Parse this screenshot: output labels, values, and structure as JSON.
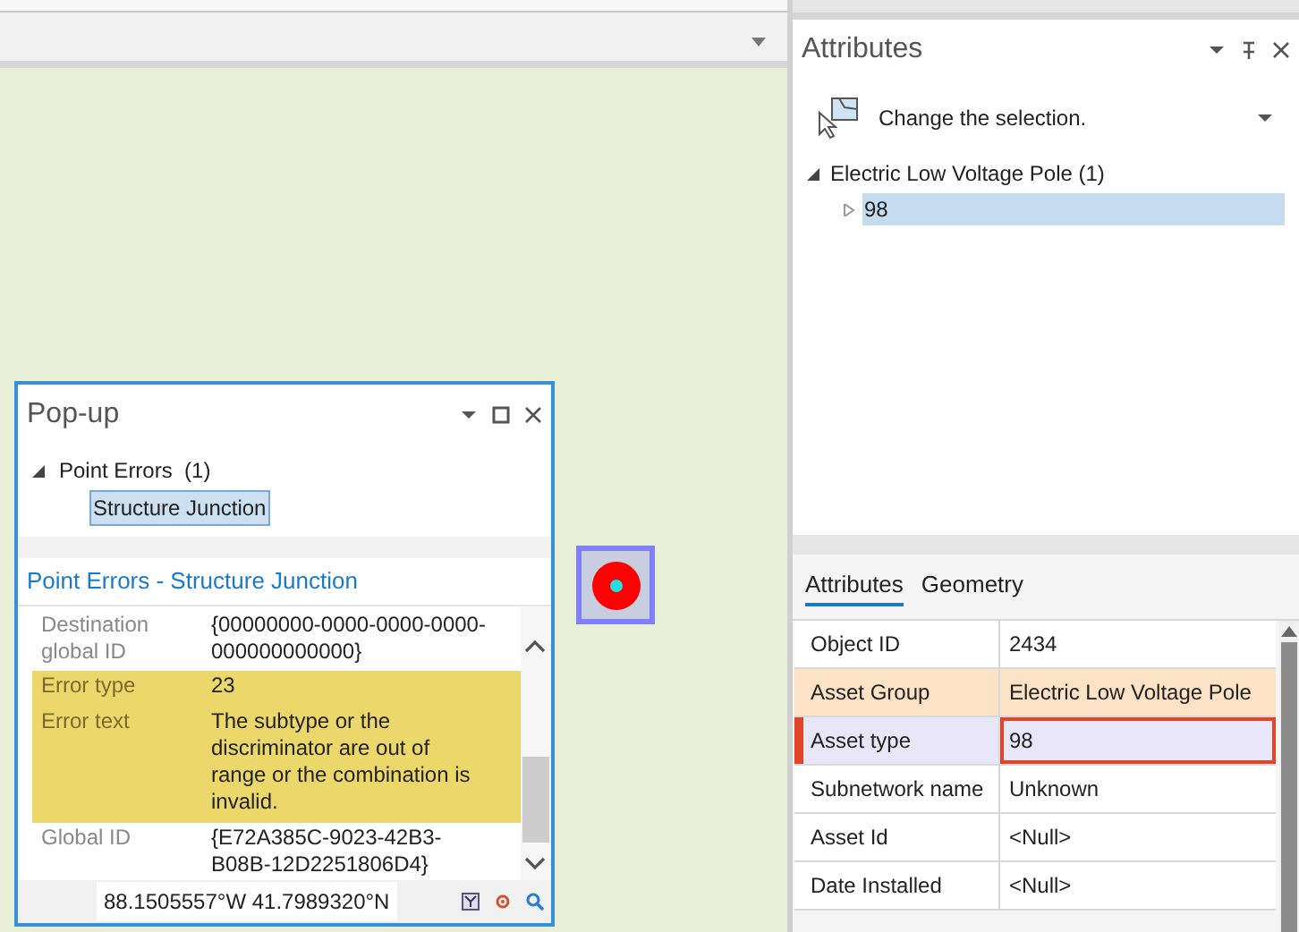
{
  "popup": {
    "title": "Pop-up",
    "tree": {
      "label": "Point Errors  (1)",
      "expanded": true,
      "children": [
        {
          "label": "Structure Junction",
          "selected": true
        }
      ]
    },
    "heading": "Point Errors - Structure Junction",
    "fields": [
      {
        "name": "Destination global ID",
        "value": "{00000000-0000-0000-0000-000000000000}",
        "highlighted": false
      },
      {
        "name": "Error type",
        "value": "23",
        "highlighted": true
      },
      {
        "name": "Error text",
        "value": "The subtype or the discriminator are out of range or the combination is invalid.",
        "highlighted": true
      },
      {
        "name": "Global ID",
        "value": "{E72A385C-9023-42B3-B08B-12D2251806D4}",
        "highlighted": false
      }
    ],
    "coordinates": "88.1505557°W 41.7989320°N"
  },
  "attributes": {
    "title": "Attributes",
    "selection_prompt": "Change the selection.",
    "tree": {
      "label": "Electric Low Voltage Pole (1)",
      "expanded": true,
      "children": [
        {
          "label": "98",
          "selected": true
        }
      ]
    },
    "tabs": [
      {
        "label": "Attributes",
        "selected": true
      },
      {
        "label": "Geometry",
        "selected": false
      }
    ],
    "rows": [
      {
        "name": "Object ID",
        "value": "2434",
        "kind": "plain"
      },
      {
        "name": "Asset Group",
        "value": "Electric Low Voltage Pole",
        "kind": "group"
      },
      {
        "name": "Asset type",
        "value": "98",
        "kind": "error"
      },
      {
        "name": "Subnetwork name",
        "value": "Unknown",
        "kind": "plain"
      },
      {
        "name": "Asset Id",
        "value": "<Null>",
        "kind": "plain"
      },
      {
        "name": "Date Installed",
        "value": "<Null>",
        "kind": "plain"
      }
    ]
  }
}
